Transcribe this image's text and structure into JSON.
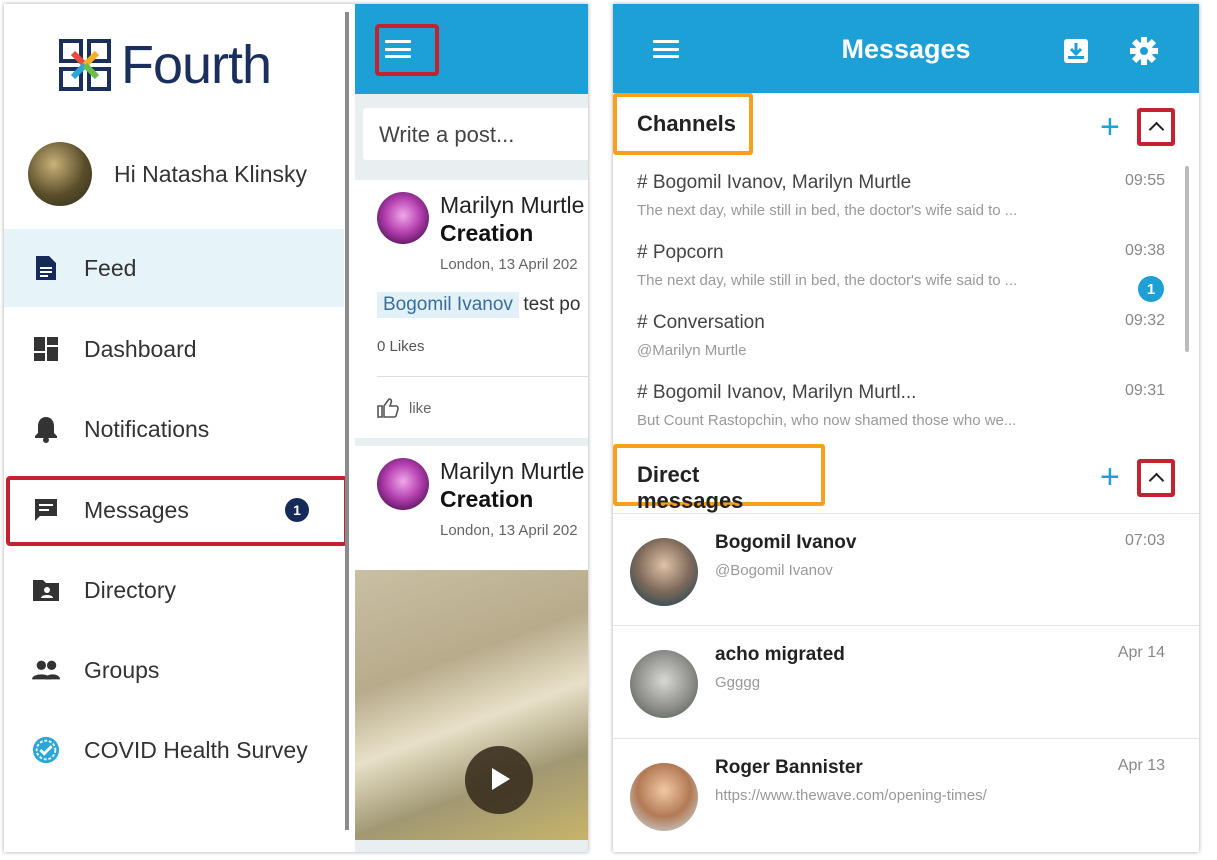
{
  "app": {
    "logo_text": "Fourth",
    "greeting": "Hi Natasha Klinsky"
  },
  "sidebar": {
    "items": [
      {
        "label": "Feed",
        "icon": "feed-icon"
      },
      {
        "label": "Dashboard",
        "icon": "dashboard-icon"
      },
      {
        "label": "Notifications",
        "icon": "bell-icon"
      },
      {
        "label": "Messages",
        "icon": "chat-icon",
        "badge": "1"
      },
      {
        "label": "Directory",
        "icon": "folder-user-icon"
      },
      {
        "label": "Groups",
        "icon": "people-icon"
      },
      {
        "label": "COVID Health Survey",
        "icon": "covid-check-icon"
      }
    ]
  },
  "feed": {
    "compose_placeholder": "Write a post...",
    "posts": [
      {
        "author": "Marilyn Murtle",
        "title": "Creation",
        "meta": "London, 13 April 202",
        "mention": "Bogomil Ivanov",
        "text": "test po",
        "likes": "0 Likes",
        "like_label": "like"
      },
      {
        "author": "Marilyn Murtle",
        "title": "Creation",
        "meta": "London, 13 April 202"
      }
    ]
  },
  "messages": {
    "title": "Messages",
    "channels_header": "Channels",
    "dm_header": "Direct messages",
    "channels": [
      {
        "name": "# Bogomil Ivanov, Marilyn Murtle",
        "preview": "The next day, while still in bed, the doctor's wife said to ...",
        "time": "09:55"
      },
      {
        "name": "# Popcorn",
        "preview": "The next day, while still in bed, the doctor's wife said to ...",
        "time": "09:38",
        "badge": "1"
      },
      {
        "name": "# Conversation",
        "preview": "@Marilyn Murtle",
        "time": "09:32"
      },
      {
        "name": "# Bogomil Ivanov, Marilyn Murtl...",
        "preview": "But Count Rastopchin, who now shamed those who we...",
        "time": "09:31"
      }
    ],
    "direct": [
      {
        "name": "Bogomil Ivanov",
        "preview": "@Bogomil Ivanov",
        "time": "07:03"
      },
      {
        "name": "acho migrated",
        "preview": "Ggggg",
        "time": "Apr 14"
      },
      {
        "name": "Roger Bannister",
        "preview": "https://www.thewave.com/opening-times/",
        "time": "Apr 13"
      }
    ]
  },
  "colors": {
    "primary": "#1da0d6",
    "navy": "#162a5a",
    "highlight_red": "#c42230",
    "highlight_orange": "#f7a01c"
  }
}
